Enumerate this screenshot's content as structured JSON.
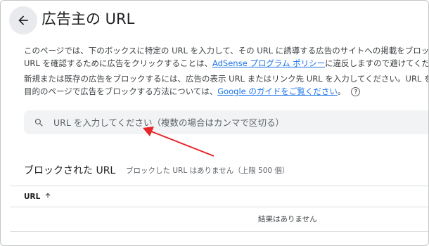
{
  "header": {
    "title": "広告主の URL",
    "back_icon": "arrow-back-icon"
  },
  "description": {
    "line1": "このページでは、下のボックスに特定の URL を入力して、その URL に誘導する広告のサイトへの掲載をブロックで",
    "line2_pre": "URL を確認するために広告をクリックすることは、",
    "line2_link": "AdSense プログラム ポリシー",
    "line2_post": "に違反しますので避けてくださいね",
    "line3": "新規または既存の広告をブロックするには、広告の表示 URL またはリンク先 URL を入力してください。URL を確認",
    "line4_pre": "目的のページで広告をブロックする方法については、",
    "line4_link": "Google のガイドをご覧ください",
    "line4_post": "。",
    "help_icon": "help-circle-icon",
    "help_glyph": "?"
  },
  "search": {
    "icon": "search-icon",
    "placeholder": "URL を入力してください（複数の場合はカンマで区切る）",
    "value": ""
  },
  "blocked": {
    "title": "ブロックされた URL",
    "note": "ブロックした URL はありません（上限 500 個）"
  },
  "table": {
    "columns": [
      {
        "label": "URL",
        "sort": "ascending",
        "sort_icon": "arrow-up-icon"
      }
    ],
    "empty_message": "結果はありません"
  },
  "annotation": {
    "color": "#e8262a",
    "icon": "red-arrow-annotation"
  }
}
